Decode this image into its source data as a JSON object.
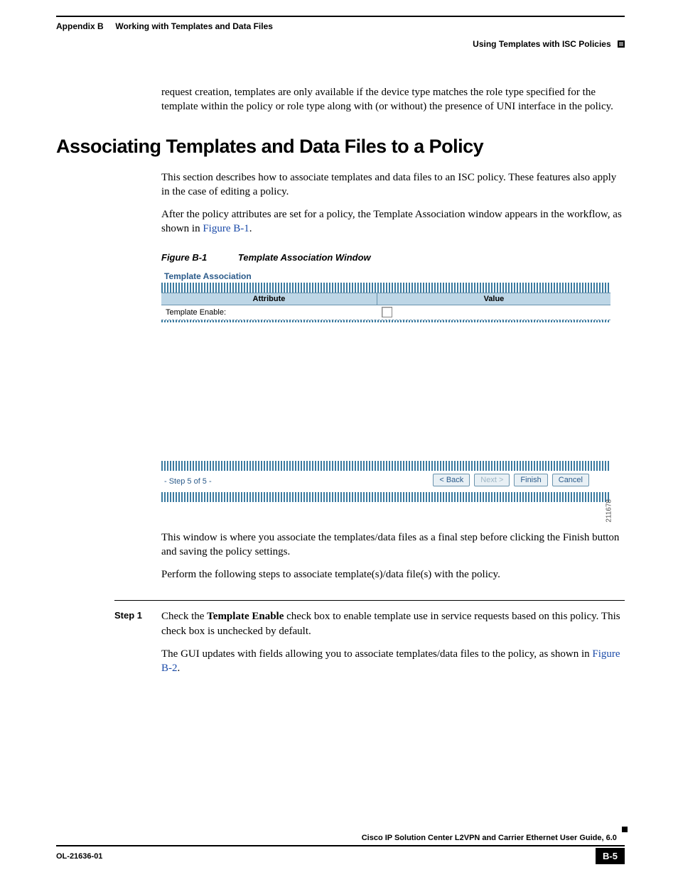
{
  "header": {
    "appendix": "Appendix B",
    "chapter": "Working with Templates and Data Files",
    "section": "Using Templates with ISC Policies"
  },
  "body": {
    "leadIn": "request creation, templates are only available if the device type matches the role type specified for the template within the policy or role type along with (or without) the presence of UNI interface in the policy.",
    "h2": "Associating Templates and Data Files to a Policy",
    "p1": "This section describes how to associate templates and data files to an ISC policy. These features also apply in the case of editing a policy.",
    "p2a": "After the policy attributes are set for a policy, the Template Association window appears in the workflow, as shown in ",
    "p2link": "Figure B-1",
    "p2b": ".",
    "figCaptionNum": "Figure B-1",
    "figCaptionTitle": "Template Association Window",
    "afterFig1": "This window is where you associate the templates/data files as a final step before clicking the Finish button and saving the policy settings.",
    "afterFig2": "Perform the following steps to associate template(s)/data file(s) with the policy."
  },
  "figure": {
    "title": "Template Association",
    "colA": "Attribute",
    "colB": "Value",
    "rowLabel": "Template Enable:",
    "stepIndicator": "- Step 5 of 5 -",
    "btnBack": "< Back",
    "btnNext": "Next >",
    "btnFinish": "Finish",
    "btnCancel": "Cancel",
    "imageId": "211678"
  },
  "steps": {
    "label1": "Step 1",
    "s1a": "Check the ",
    "s1bold": "Template Enable",
    "s1b": " check box to enable template use in service requests based on this policy. This check box is unchecked by default.",
    "s1c1": "The GUI updates with fields allowing you to associate templates/data files to the policy, as shown in ",
    "s1link": "Figure B-2",
    "s1c2": "."
  },
  "footer": {
    "guide": "Cisco IP Solution Center L2VPN and Carrier Ethernet User Guide, 6.0",
    "docId": "OL-21636-01",
    "pageNum": "B-5"
  }
}
